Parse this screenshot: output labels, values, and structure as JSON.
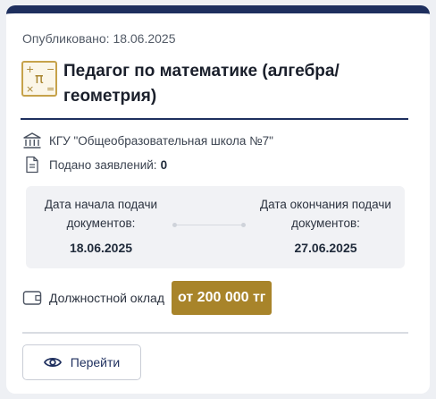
{
  "vacancy": {
    "published_label": "Опубликовано: 18.06.2025",
    "title": "Педагог по математике (алгебра/геометрия)",
    "organization": "КГУ \"Общеобразовательная школа №7\"",
    "applications_label": "Подано заявлений:",
    "applications_count": "0"
  },
  "dates": {
    "start_label": "Дата начала подачи документов:",
    "start_value": "18.06.2025",
    "end_label": "Дата окончания подачи документов:",
    "end_value": "27.06.2025"
  },
  "salary": {
    "label": "Должностной оклад",
    "value": "от 200 000 тг"
  },
  "actions": {
    "go_label": "Перейти"
  },
  "icons": {
    "subject": "math-subject-icon",
    "organization": "bank-building-icon",
    "applications": "document-icon",
    "salary": "wallet-icon",
    "go": "eye-icon"
  },
  "colors": {
    "header_bar": "#1e2f5e",
    "salary_badge": "#a8842a",
    "subject_icon": "#c6a24a"
  }
}
